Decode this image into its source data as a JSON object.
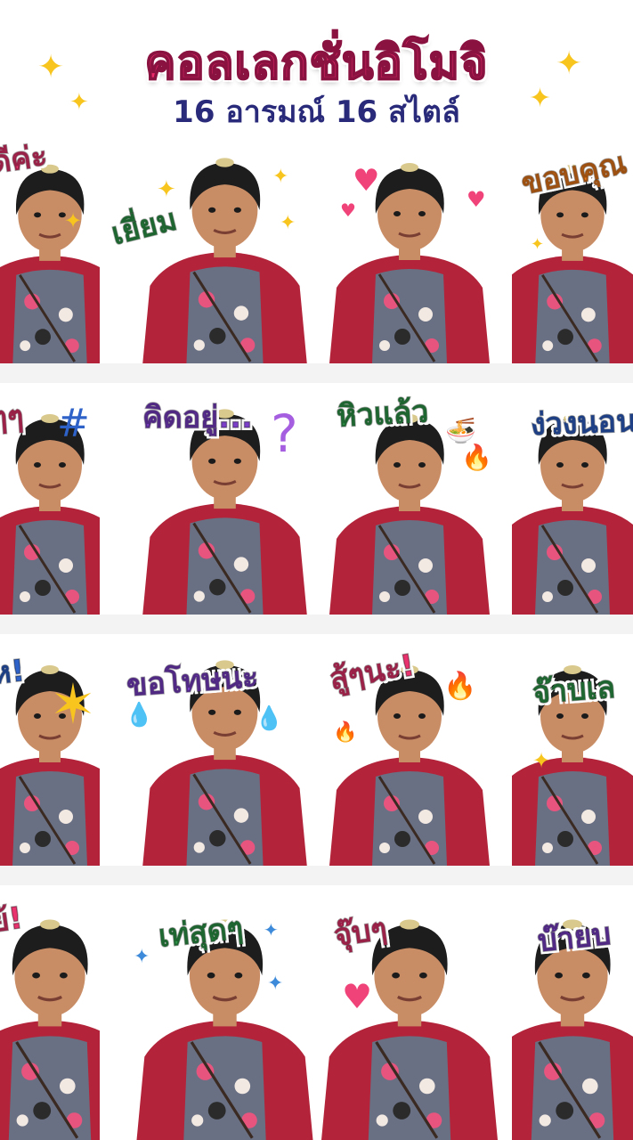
{
  "title": "คอลเลกชั่นอิโมจิ",
  "subtitle": "16 อารมณ์ 16 สไตล์",
  "colors": {
    "title": "#ee2a6b",
    "subtitle": "#2a2a7a",
    "hoodie": "#b3243a",
    "shirt": "#6a7084",
    "skin": "#c98d66",
    "hair": "#1d1d1d",
    "spark": "#f7c51e"
  },
  "stickers": [
    {
      "caption": "ดีค่ะ",
      "color": "#e8336e"
    },
    {
      "caption": "เยี่ยม",
      "color": "#2e9a4a"
    },
    {
      "caption": "",
      "color": "#e8336e"
    },
    {
      "caption": "ขอบคุณ",
      "color": "#ef7b1d"
    },
    {
      "caption": "ๆๆ",
      "color": "#e8336e"
    },
    {
      "caption": "คิดอยู่...",
      "color": "#7b3fc9"
    },
    {
      "caption": "หิวแล้ว",
      "color": "#2e9a4a"
    },
    {
      "caption": "ง่วงนอน",
      "color": "#2e62c9"
    },
    {
      "caption": "ห!",
      "color": "#2e62c9"
    },
    {
      "caption": "ขอโทษนะ",
      "color": "#7b3fc9"
    },
    {
      "caption": "สู้ๆนะ!",
      "color": "#e8336e"
    },
    {
      "caption": "จ๊าบเล",
      "color": "#2e9a4a"
    },
    {
      "caption": "ย้!",
      "color": "#e8336e"
    },
    {
      "caption": "เท่สุดๆ",
      "color": "#2e9a4a"
    },
    {
      "caption": "จุ๊บๆ",
      "color": "#e8336e"
    },
    {
      "caption": "บ๊ายบ",
      "color": "#7b3fc9"
    }
  ],
  "decorations": {
    "heart": "♥",
    "sparkle": "✦",
    "question": "?",
    "fire": "🔥",
    "bowl": "🍜",
    "drop": "💧",
    "burst": "✶",
    "hash": "#"
  }
}
